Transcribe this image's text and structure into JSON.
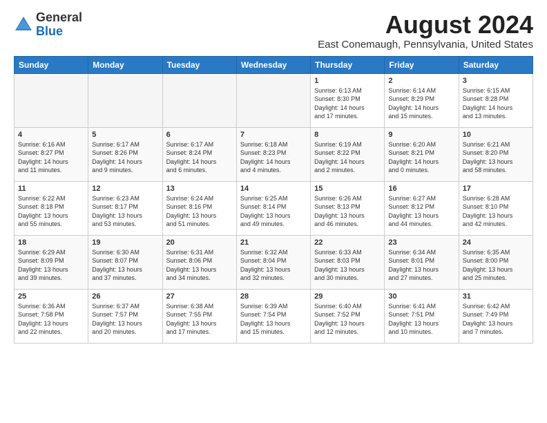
{
  "logo": {
    "general": "General",
    "blue": "Blue"
  },
  "title": "August 2024",
  "location": "East Conemaugh, Pennsylvania, United States",
  "days_of_week": [
    "Sunday",
    "Monday",
    "Tuesday",
    "Wednesday",
    "Thursday",
    "Friday",
    "Saturday"
  ],
  "weeks": [
    [
      {
        "day": "",
        "empty": true
      },
      {
        "day": "",
        "empty": true
      },
      {
        "day": "",
        "empty": true
      },
      {
        "day": "",
        "empty": true
      },
      {
        "day": "1",
        "lines": [
          "Sunrise: 6:13 AM",
          "Sunset: 8:30 PM",
          "Daylight: 14 hours",
          "and 17 minutes."
        ]
      },
      {
        "day": "2",
        "lines": [
          "Sunrise: 6:14 AM",
          "Sunset: 8:29 PM",
          "Daylight: 14 hours",
          "and 15 minutes."
        ]
      },
      {
        "day": "3",
        "lines": [
          "Sunrise: 6:15 AM",
          "Sunset: 8:28 PM",
          "Daylight: 14 hours",
          "and 13 minutes."
        ]
      }
    ],
    [
      {
        "day": "4",
        "lines": [
          "Sunrise: 6:16 AM",
          "Sunset: 8:27 PM",
          "Daylight: 14 hours",
          "and 11 minutes."
        ]
      },
      {
        "day": "5",
        "lines": [
          "Sunrise: 6:17 AM",
          "Sunset: 8:26 PM",
          "Daylight: 14 hours",
          "and 9 minutes."
        ]
      },
      {
        "day": "6",
        "lines": [
          "Sunrise: 6:17 AM",
          "Sunset: 8:24 PM",
          "Daylight: 14 hours",
          "and 6 minutes."
        ]
      },
      {
        "day": "7",
        "lines": [
          "Sunrise: 6:18 AM",
          "Sunset: 8:23 PM",
          "Daylight: 14 hours",
          "and 4 minutes."
        ]
      },
      {
        "day": "8",
        "lines": [
          "Sunrise: 6:19 AM",
          "Sunset: 8:22 PM",
          "Daylight: 14 hours",
          "and 2 minutes."
        ]
      },
      {
        "day": "9",
        "lines": [
          "Sunrise: 6:20 AM",
          "Sunset: 8:21 PM",
          "Daylight: 14 hours",
          "and 0 minutes."
        ]
      },
      {
        "day": "10",
        "lines": [
          "Sunrise: 6:21 AM",
          "Sunset: 8:20 PM",
          "Daylight: 13 hours",
          "and 58 minutes."
        ]
      }
    ],
    [
      {
        "day": "11",
        "lines": [
          "Sunrise: 6:22 AM",
          "Sunset: 8:18 PM",
          "Daylight: 13 hours",
          "and 55 minutes."
        ]
      },
      {
        "day": "12",
        "lines": [
          "Sunrise: 6:23 AM",
          "Sunset: 8:17 PM",
          "Daylight: 13 hours",
          "and 53 minutes."
        ]
      },
      {
        "day": "13",
        "lines": [
          "Sunrise: 6:24 AM",
          "Sunset: 8:16 PM",
          "Daylight: 13 hours",
          "and 51 minutes."
        ]
      },
      {
        "day": "14",
        "lines": [
          "Sunrise: 6:25 AM",
          "Sunset: 8:14 PM",
          "Daylight: 13 hours",
          "and 49 minutes."
        ]
      },
      {
        "day": "15",
        "lines": [
          "Sunrise: 6:26 AM",
          "Sunset: 8:13 PM",
          "Daylight: 13 hours",
          "and 46 minutes."
        ]
      },
      {
        "day": "16",
        "lines": [
          "Sunrise: 6:27 AM",
          "Sunset: 8:12 PM",
          "Daylight: 13 hours",
          "and 44 minutes."
        ]
      },
      {
        "day": "17",
        "lines": [
          "Sunrise: 6:28 AM",
          "Sunset: 8:10 PM",
          "Daylight: 13 hours",
          "and 42 minutes."
        ]
      }
    ],
    [
      {
        "day": "18",
        "lines": [
          "Sunrise: 6:29 AM",
          "Sunset: 8:09 PM",
          "Daylight: 13 hours",
          "and 39 minutes."
        ]
      },
      {
        "day": "19",
        "lines": [
          "Sunrise: 6:30 AM",
          "Sunset: 8:07 PM",
          "Daylight: 13 hours",
          "and 37 minutes."
        ]
      },
      {
        "day": "20",
        "lines": [
          "Sunrise: 6:31 AM",
          "Sunset: 8:06 PM",
          "Daylight: 13 hours",
          "and 34 minutes."
        ]
      },
      {
        "day": "21",
        "lines": [
          "Sunrise: 6:32 AM",
          "Sunset: 8:04 PM",
          "Daylight: 13 hours",
          "and 32 minutes."
        ]
      },
      {
        "day": "22",
        "lines": [
          "Sunrise: 6:33 AM",
          "Sunset: 8:03 PM",
          "Daylight: 13 hours",
          "and 30 minutes."
        ]
      },
      {
        "day": "23",
        "lines": [
          "Sunrise: 6:34 AM",
          "Sunset: 8:01 PM",
          "Daylight: 13 hours",
          "and 27 minutes."
        ]
      },
      {
        "day": "24",
        "lines": [
          "Sunrise: 6:35 AM",
          "Sunset: 8:00 PM",
          "Daylight: 13 hours",
          "and 25 minutes."
        ]
      }
    ],
    [
      {
        "day": "25",
        "lines": [
          "Sunrise: 6:36 AM",
          "Sunset: 7:58 PM",
          "Daylight: 13 hours",
          "and 22 minutes."
        ]
      },
      {
        "day": "26",
        "lines": [
          "Sunrise: 6:37 AM",
          "Sunset: 7:57 PM",
          "Daylight: 13 hours",
          "and 20 minutes."
        ]
      },
      {
        "day": "27",
        "lines": [
          "Sunrise: 6:38 AM",
          "Sunset: 7:55 PM",
          "Daylight: 13 hours",
          "and 17 minutes."
        ]
      },
      {
        "day": "28",
        "lines": [
          "Sunrise: 6:39 AM",
          "Sunset: 7:54 PM",
          "Daylight: 13 hours",
          "and 15 minutes."
        ]
      },
      {
        "day": "29",
        "lines": [
          "Sunrise: 6:40 AM",
          "Sunset: 7:52 PM",
          "Daylight: 13 hours",
          "and 12 minutes."
        ]
      },
      {
        "day": "30",
        "lines": [
          "Sunrise: 6:41 AM",
          "Sunset: 7:51 PM",
          "Daylight: 13 hours",
          "and 10 minutes."
        ]
      },
      {
        "day": "31",
        "lines": [
          "Sunrise: 6:42 AM",
          "Sunset: 7:49 PM",
          "Daylight: 13 hours",
          "and 7 minutes."
        ]
      }
    ]
  ]
}
